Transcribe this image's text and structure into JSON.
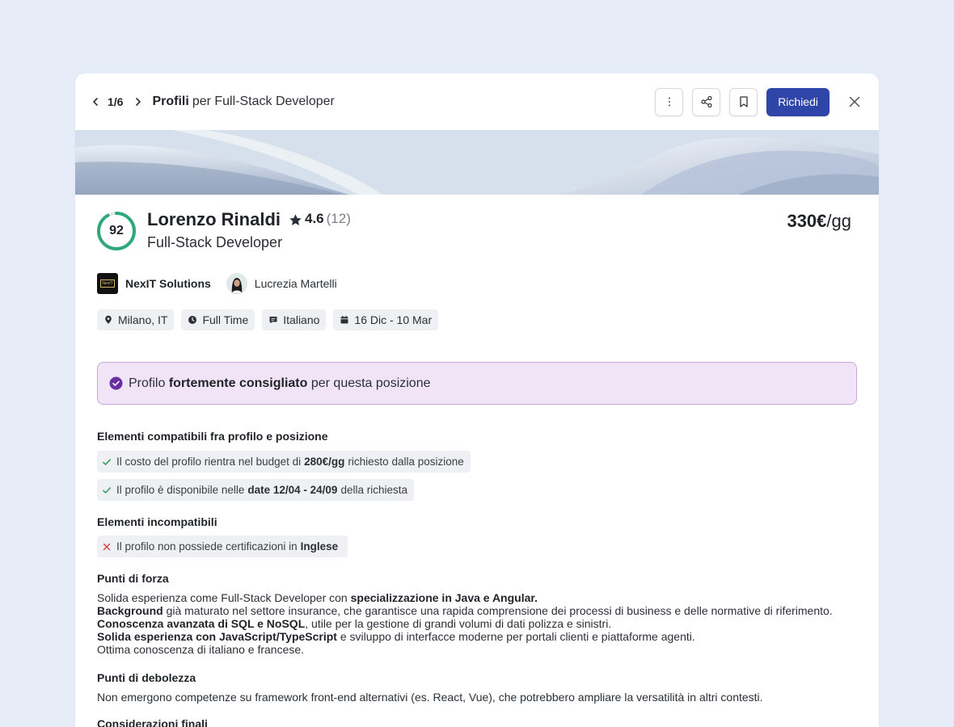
{
  "header": {
    "counter": "1/6",
    "title_bold": "Profili",
    "title_rest": "per Full-Stack Developer",
    "request_label": "Richiedi",
    "icons": [
      "chevron-left-icon",
      "chevron-right-icon",
      "more-vertical-icon",
      "share-icon",
      "bookmark-icon",
      "close-icon"
    ]
  },
  "profile": {
    "score": "92",
    "score_fraction": 0.92,
    "name": "Lorenzo Rinaldi",
    "rating": "4.6",
    "rating_count": "(12)",
    "role": "Full-Stack Developer",
    "price_value": "330€",
    "price_unit": "/gg",
    "company_name": "NexIT Solutions",
    "company_logo_text": "NexIT",
    "person_name": "Lucrezia Martelli"
  },
  "chips": [
    {
      "icon": "location-pin-icon",
      "label": "Milano, IT"
    },
    {
      "icon": "clock-icon",
      "label": "Full Time"
    },
    {
      "icon": "chat-icon",
      "label": "Italiano"
    },
    {
      "icon": "calendar-icon",
      "label": "16 Dic - 10 Mar"
    }
  ],
  "recommendation": {
    "pre": "Profilo",
    "bold": "fortemente consigliato",
    "post": "per questa posizione"
  },
  "compatible": {
    "title": "Elementi compatibili fra profilo e posizione",
    "items": [
      {
        "pre": "Il costo del profilo rientra nel budget di",
        "bold": "280€/gg",
        "post": "richiesto dalla posizione"
      },
      {
        "pre": "Il profilo è disponibile nelle",
        "bold": "date 12/04 - 24/09",
        "post": "della richiesta"
      }
    ]
  },
  "incompatible": {
    "title": "Elementi incompatibili",
    "items": [
      {
        "pre": "Il profilo non possiede certificazioni in",
        "bold": "Inglese",
        "post": ""
      }
    ]
  },
  "strengths": {
    "title": "Punti di forza",
    "lines": [
      {
        "pre": "Solida esperienza come Full-Stack Developer con ",
        "bold": "specializzazione in Java e Angular.",
        "post": ""
      },
      {
        "pre": "",
        "bold": "Background",
        "post": " già maturato nel settore insurance, che garantisce una rapida comprensione dei processi di business e delle normative di riferimento."
      },
      {
        "pre": "",
        "bold": "Conoscenza avanzata di SQL e NoSQL",
        "post": ", utile per la gestione di grandi volumi di dati polizza e sinistri."
      },
      {
        "pre": "",
        "bold": "Solida esperienza con JavaScript/TypeScript",
        "post": " e sviluppo di interfacce moderne per portali clienti e piattaforme agenti."
      },
      {
        "pre": "Ottima conoscenza di italiano e francese.",
        "bold": "",
        "post": ""
      }
    ]
  },
  "weaknesses": {
    "title": "Punti di debolezza",
    "text": "Non emergono competenze su framework front-end alternativi (es. React, Vue), che potrebbero ampliare la versatilità in altri contesti."
  },
  "final": {
    "title": "Considerazioni finali"
  },
  "colors": {
    "primary": "#2f45a8",
    "score_ring": "#2eaa7a",
    "recommend_bg": "#f1e4f7",
    "recommend_border": "#c7a4dc",
    "check": "#2e9a5a",
    "cross": "#d64545",
    "badge_purple": "#6a2fa0"
  }
}
